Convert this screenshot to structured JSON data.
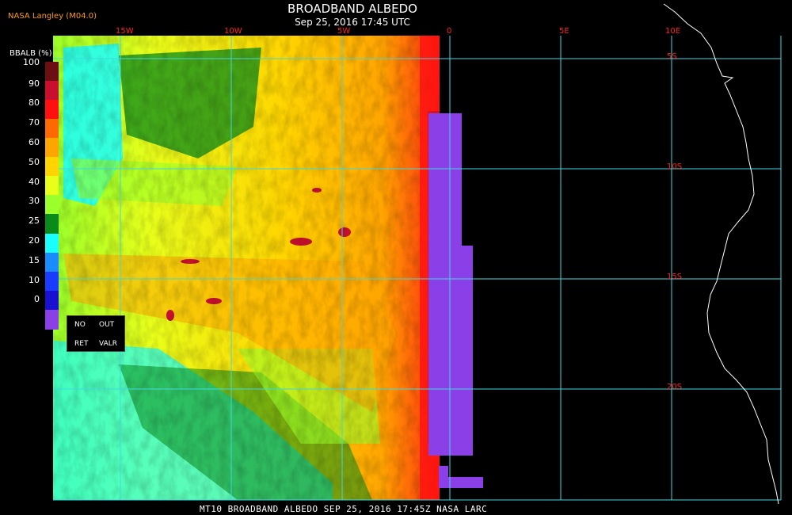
{
  "header": {
    "title": "BROADBAND ALBEDO",
    "subtitle": "Sep 25, 2016 17:45 UTC",
    "credit": "NASA Langley (M04.0)"
  },
  "footer": "MT10   BROADBAND ALBEDO   SEP 25, 2016 17:45Z   NASA LARC",
  "grid": {
    "longitudes": [
      "15W",
      "10W",
      "5W",
      "0",
      "5E",
      "10E"
    ],
    "latitudes": [
      "5S",
      "10S",
      "15S",
      "20S"
    ]
  },
  "legend": {
    "title": "BBALB (%)",
    "ticks": [
      "100",
      "90",
      "80",
      "70",
      "60",
      "50",
      "40",
      "30",
      "25",
      "20",
      "15",
      "10",
      "0"
    ],
    "colors": [
      "#6b0f12",
      "#c8102e",
      "#ff1010",
      "#ff6a00",
      "#ffa500",
      "#ffd400",
      "#e8ff1a",
      "#9aff2a",
      "#0a8a1a",
      "#19ffff",
      "#1a8cff",
      "#1a3cff",
      "#1a10d0",
      "#8b3fe6"
    ],
    "no_data_labels": [
      "NO",
      "OUT",
      "RET",
      "VALR"
    ]
  },
  "colors": {
    "grid_line": "#3fd8e0",
    "grid_label": "#ff2020",
    "coastline": "#ffffff",
    "no_retrieval": "#8b3fe6"
  }
}
